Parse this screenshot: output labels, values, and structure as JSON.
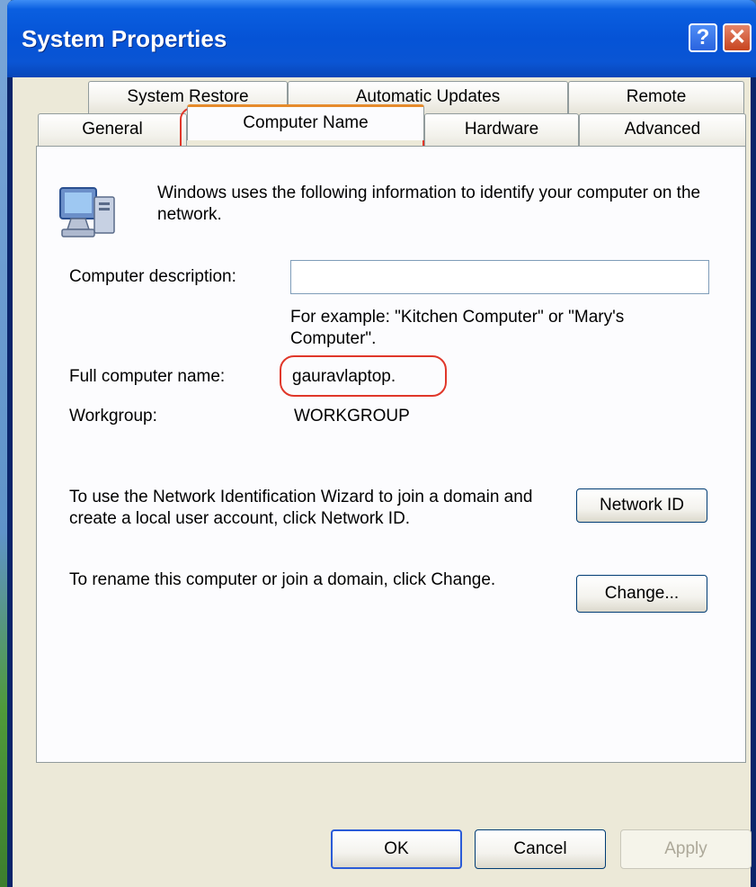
{
  "window": {
    "title": "System Properties",
    "help_label": "?",
    "close_label": "✕"
  },
  "tabs": {
    "row_back": [
      "System Restore",
      "Automatic Updates",
      "Remote"
    ],
    "row_front": [
      "General",
      "Computer Name",
      "Hardware",
      "Advanced"
    ],
    "active": "Computer Name"
  },
  "panel": {
    "intro": "Windows uses the following information to identify your computer on the network.",
    "description_label": "Computer description:",
    "description_value": "",
    "description_example": "For example: \"Kitchen Computer\" or \"Mary's Computer\".",
    "full_name_label": "Full computer name:",
    "full_name_value": "gauravlaptop.",
    "workgroup_label": "Workgroup:",
    "workgroup_value": "WORKGROUP",
    "network_id_text": "To use the Network Identification Wizard to join a domain and create a local user account, click Network ID.",
    "network_id_button": "Network ID",
    "change_text": "To rename this computer or join a domain, click Change.",
    "change_button": "Change..."
  },
  "footer": {
    "ok": "OK",
    "cancel": "Cancel",
    "apply": "Apply"
  },
  "icons": [
    "computer-icon",
    "help-icon",
    "close-icon"
  ],
  "colors": {
    "titlebar": "#0553d6",
    "active_tab_accent": "#e68b2c",
    "annotation": "#e0372a",
    "dialog_bg": "#ece9d8"
  }
}
